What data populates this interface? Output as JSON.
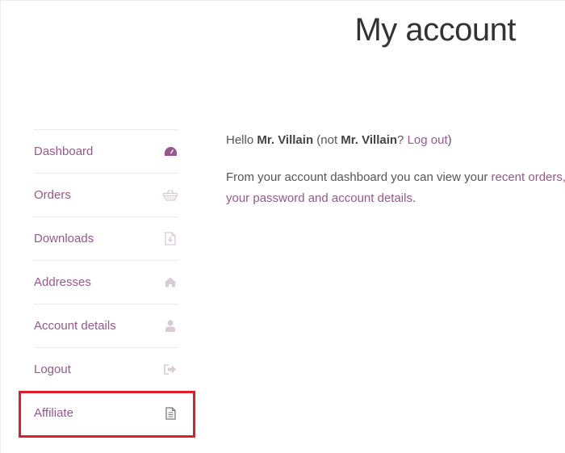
{
  "page": {
    "title": "My account"
  },
  "nav": {
    "items": [
      {
        "label": "Dashboard",
        "icon": "dashboard-icon"
      },
      {
        "label": "Orders",
        "icon": "basket-icon"
      },
      {
        "label": "Downloads",
        "icon": "file-download-icon"
      },
      {
        "label": "Addresses",
        "icon": "home-icon"
      },
      {
        "label": "Account details",
        "icon": "user-icon"
      },
      {
        "label": "Logout",
        "icon": "sign-out-icon"
      },
      {
        "label": "Affiliate",
        "icon": "document-icon"
      }
    ],
    "active_index": 0,
    "highlighted_index": 6
  },
  "content": {
    "greeting_hello": "Hello ",
    "greeting_name": "Mr. Villain",
    "greeting_not": " (not ",
    "greeting_name2": "Mr. Villain",
    "greeting_q": "? ",
    "logout_link": "Log out",
    "greeting_close": ")",
    "dashboard_text_1": "From your account dashboard you can view your ",
    "recent_orders_link": "recent orders,",
    "dashboard_text_2": "",
    "edit_link": "your password and account details",
    "dashboard_text_3": "."
  },
  "colors": {
    "accent": "#96588a",
    "icon_inactive": "#d9cbd6",
    "highlight_border": "#e11d2a",
    "title": "#333333"
  }
}
